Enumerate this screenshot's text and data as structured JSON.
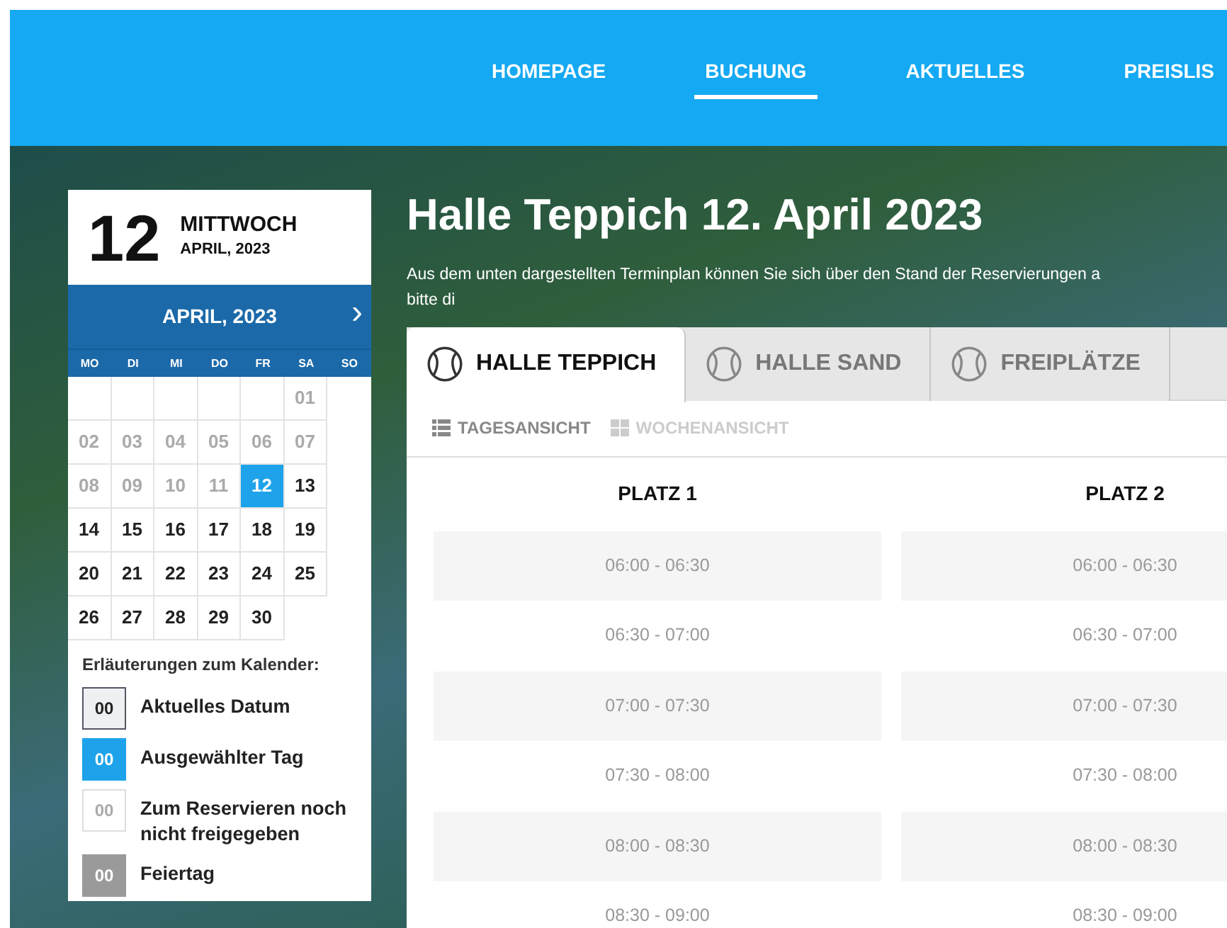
{
  "nav": {
    "items": [
      {
        "label": "HOMEPAGE",
        "selected": false
      },
      {
        "label": "BUCHUNG",
        "selected": true
      },
      {
        "label": "AKTUELLES",
        "selected": false
      },
      {
        "label": "PREISLIS",
        "selected": false
      }
    ]
  },
  "calendar": {
    "day_number": "12",
    "weekday": "MITTWOCH",
    "month_year": "APRIL, 2023",
    "month_title": "APRIL, 2023",
    "next": "›",
    "weekdays": [
      "MO",
      "DI",
      "MI",
      "DO",
      "FR",
      "SA",
      "SO"
    ],
    "weeks": [
      [
        {
          "kind": "blank"
        },
        {
          "kind": "blank"
        },
        {
          "kind": "blank"
        },
        {
          "kind": "blank"
        },
        {
          "kind": "blank"
        },
        {
          "kind": "day",
          "label": "01",
          "released": false,
          "selected": false
        }
      ],
      [
        {
          "label": "02",
          "released": false,
          "selected": false
        },
        {
          "label": "03",
          "released": false,
          "selected": false
        },
        {
          "label": "04",
          "released": false,
          "selected": false
        },
        {
          "label": "05",
          "released": false,
          "selected": false
        },
        {
          "label": "06",
          "released": false,
          "selected": false
        },
        {
          "label": "07",
          "released": false,
          "selected": false
        }
      ],
      [
        {
          "label": "08",
          "released": false,
          "selected": false
        },
        {
          "label": "09",
          "released": false,
          "selected": false
        },
        {
          "label": "10",
          "released": false,
          "selected": false
        },
        {
          "label": "11",
          "released": false,
          "selected": false
        },
        {
          "label": "12",
          "released": true,
          "selected": true
        },
        {
          "label": "13",
          "released": true,
          "selected": false
        }
      ],
      [
        {
          "label": "14",
          "released": true,
          "selected": false
        },
        {
          "label": "15",
          "released": true,
          "selected": false
        },
        {
          "label": "16",
          "released": true,
          "selected": false
        },
        {
          "label": "17",
          "released": true,
          "selected": false
        },
        {
          "label": "18",
          "released": true,
          "selected": false
        },
        {
          "label": "19",
          "released": true,
          "selected": false
        }
      ],
      [
        {
          "label": "20",
          "released": true,
          "selected": false
        },
        {
          "label": "21",
          "released": true,
          "selected": false
        },
        {
          "label": "22",
          "released": true,
          "selected": false
        },
        {
          "label": "23",
          "released": true,
          "selected": false
        },
        {
          "label": "24",
          "released": true,
          "selected": false
        },
        {
          "label": "25",
          "released": true,
          "selected": false
        }
      ],
      [
        {
          "label": "26",
          "released": true,
          "selected": false
        },
        {
          "label": "27",
          "released": true,
          "selected": false
        },
        {
          "label": "28",
          "released": true,
          "selected": false
        },
        {
          "label": "29",
          "released": true,
          "selected": false
        },
        {
          "label": "30",
          "released": true,
          "selected": false
        }
      ]
    ],
    "legend_title": "Erläuterungen zum Kalender:",
    "legend": [
      {
        "kind": "current",
        "swatch": "00",
        "label": "Aktuelles Datum"
      },
      {
        "kind": "selected",
        "swatch": "00",
        "label": "Ausgewählter Tag"
      },
      {
        "kind": "unreleased",
        "swatch": "00",
        "label": "Zum Reservieren noch nicht freigegeben"
      },
      {
        "kind": "holiday",
        "swatch": "00",
        "label": "Feiertag"
      }
    ]
  },
  "page": {
    "title": "Halle Teppich 12. April 2023",
    "description": [
      "Aus dem unten dargestellten Terminplan können Sie sich über den Stand der Reservierungen a",
      "bitte di"
    ]
  },
  "tabs": [
    {
      "label": "HALLE TEPPICH",
      "selected": true
    },
    {
      "label": "HALLE SAND",
      "selected": false
    },
    {
      "label": "FREIPLÄTZE",
      "selected": false
    }
  ],
  "views": [
    {
      "kind": "list",
      "label": "TAGESANSICHT",
      "selected": true
    },
    {
      "kind": "grid",
      "label": "WOCHENANSICHT",
      "selected": false
    }
  ],
  "courts": [
    {
      "name": "PLATZ 1",
      "slots": [
        "06:00 - 06:30",
        "06:30 - 07:00",
        "07:00 - 07:30",
        "07:30 - 08:00",
        "08:00 - 08:30",
        "08:30 - 09:00"
      ]
    },
    {
      "name": "PLATZ 2",
      "slots": [
        "06:00 - 06:30",
        "06:30 - 07:00",
        "07:00 - 07:30",
        "07:30 - 08:00",
        "08:00 - 08:30",
        "08:30 - 09:00"
      ]
    }
  ]
}
